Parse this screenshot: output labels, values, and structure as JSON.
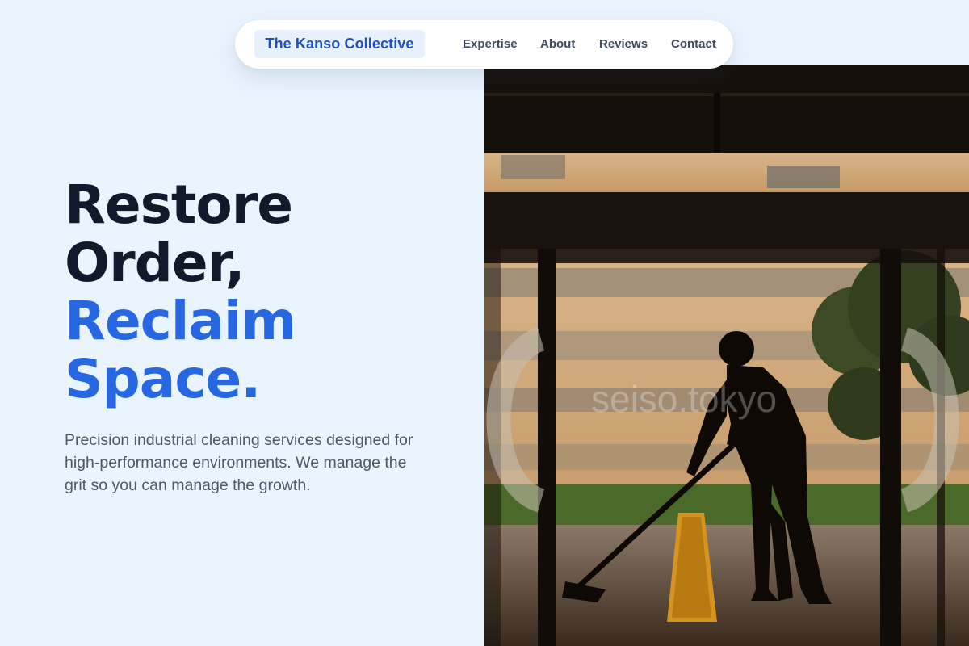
{
  "nav": {
    "brand": "The Kanso Collective",
    "links": [
      "Expertise",
      "About",
      "Reviews",
      "Contact"
    ]
  },
  "hero": {
    "headline_line1": "Restore",
    "headline_line2": "Order,",
    "headline_line3": "Reclaim",
    "headline_line4": "Space.",
    "subtext": "Precision industrial cleaning services designed for high-performance environments. We manage the grit so you can manage the growth."
  },
  "photo": {
    "description_icon": "janitor-mopping-silhouette",
    "watermark": "seiso.tokyo"
  },
  "colors": {
    "background": "#eaf4fe",
    "accent_blue": "#2767e2",
    "brand_blue": "#1f4fc1",
    "heading_dark": "#0f1b2d"
  }
}
